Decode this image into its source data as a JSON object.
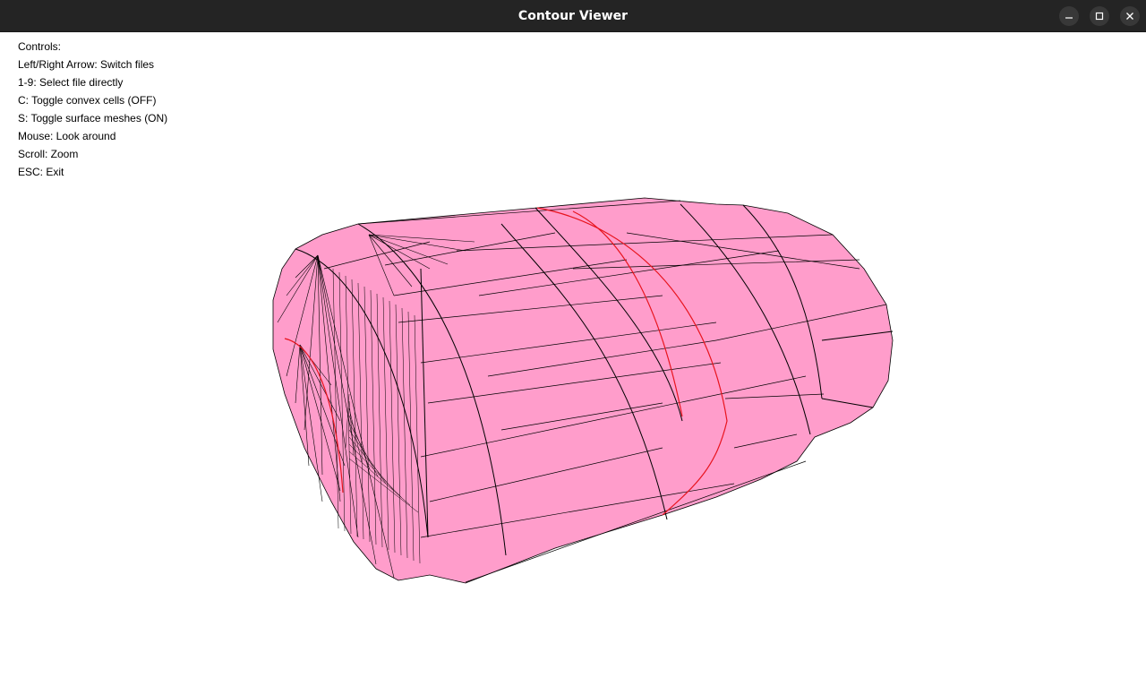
{
  "window": {
    "title": "Contour Viewer",
    "minimize_icon": "minimize-icon",
    "maximize_icon": "maximize-icon",
    "close_icon": "close-icon"
  },
  "controls": {
    "heading": "Controls:",
    "lines": [
      "Left/Right Arrow: Switch files",
      "1-9: Select file directly",
      "C: Toggle convex cells (OFF)",
      "S: Toggle surface meshes (ON)",
      "Mouse: Look around",
      "Scroll: Zoom",
      "ESC: Exit"
    ]
  },
  "scene": {
    "mesh_fill_color": "#ff9dcb",
    "edge_color": "#000000",
    "contour_color": "#e8141e",
    "background_color": "#ffffff"
  }
}
